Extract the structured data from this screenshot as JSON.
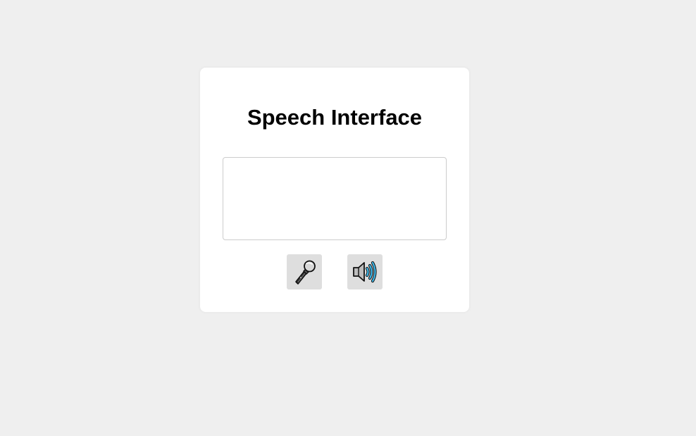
{
  "card": {
    "title": "Speech Interface"
  },
  "text_area": {
    "value": "",
    "placeholder": ""
  },
  "buttons": {
    "mic": {
      "icon": "microphone-icon"
    },
    "speaker": {
      "icon": "speaker-icon"
    }
  },
  "colors": {
    "background": "#efefef",
    "card": "#ffffff",
    "button": "#dedede",
    "speaker_waves": "#3fb7e8"
  }
}
